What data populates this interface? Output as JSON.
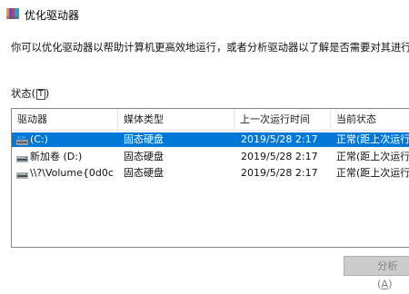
{
  "window": {
    "title": "优化驱动器"
  },
  "description": "你可以优化驱动器以帮助计算机更高效地运行，或者分析驱动器以了解是否需要对其进行优化。",
  "status": {
    "label": "状态",
    "accelerator": "T"
  },
  "table": {
    "columns": [
      "驱动器",
      "媒体类型",
      "上一次运行时间",
      "当前状态"
    ],
    "rows": [
      {
        "drive": "(C:)",
        "media": "固态硬盘",
        "last_run": "2019/5/28 2:17",
        "state": "正常(距上次运行",
        "icon": "windows-drive-icon",
        "selected": true
      },
      {
        "drive": "新加卷 (D:)",
        "media": "固态硬盘",
        "last_run": "2019/5/28 2:17",
        "state": "正常(距上次运行",
        "icon": "drive-icon",
        "selected": false
      },
      {
        "drive": "\\\\?\\Volume{0d0c",
        "media": "固态硬盘",
        "last_run": "2019/5/28 2:17",
        "state": "正常(距上次运行",
        "icon": "drive-icon",
        "selected": false
      }
    ]
  },
  "buttons": {
    "analyze": "分析",
    "analyze_accel": "A"
  },
  "colors": {
    "selection": "#0078d7",
    "border": "#828790"
  }
}
